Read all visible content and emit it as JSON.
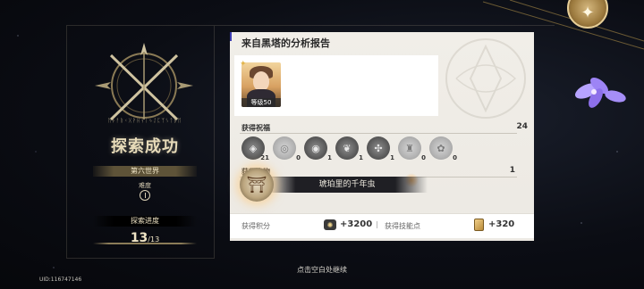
{
  "left": {
    "rune_text": "ᚢᚦᚨᚱᚲᚷᚹᚺᚾᛁᛃᛇᛈᛉᛊᛏᛒᛖ",
    "title": "探索成功",
    "world": "第六世界",
    "difficulty_label": "难度",
    "progress_label": "探索进度",
    "progress_current": "13",
    "progress_total": "/13"
  },
  "report": {
    "title": "来自黑塔的分析报告",
    "player_level": "等级50",
    "blessing_label": "获得祝福",
    "blessing_total": "24",
    "blessings": [
      {
        "icon": "preservation-icon",
        "glyph": "◈",
        "count": "21",
        "style": "dark"
      },
      {
        "icon": "remembrance-icon",
        "glyph": "◎",
        "count": "0",
        "style": "light"
      },
      {
        "icon": "nihility-icon",
        "glyph": "◉",
        "count": "1",
        "style": "dark"
      },
      {
        "icon": "abundance-icon",
        "glyph": "❦",
        "count": "1",
        "style": "dark"
      },
      {
        "icon": "hunt-icon",
        "glyph": "✣",
        "count": "1",
        "style": "dark"
      },
      {
        "icon": "destruction-icon",
        "glyph": "♜",
        "count": "0",
        "style": "light"
      },
      {
        "icon": "elation-icon",
        "glyph": "✿",
        "count": "0",
        "style": "light"
      }
    ],
    "curio_label": "获得奇物",
    "curio_total": "1",
    "curio_name": "琥珀里的千年虫",
    "score_label": "获得积分",
    "score_value": "+3200",
    "skill_label": "获得技能点",
    "skill_value": "+320"
  },
  "footer": {
    "continue_hint": "点击空白处继续",
    "uid": "UID:116747146"
  },
  "colors": {
    "accent_gold": "#e7dbb9",
    "report_bg": "#f1eee8",
    "accent_blue": "#3b3bb0"
  }
}
